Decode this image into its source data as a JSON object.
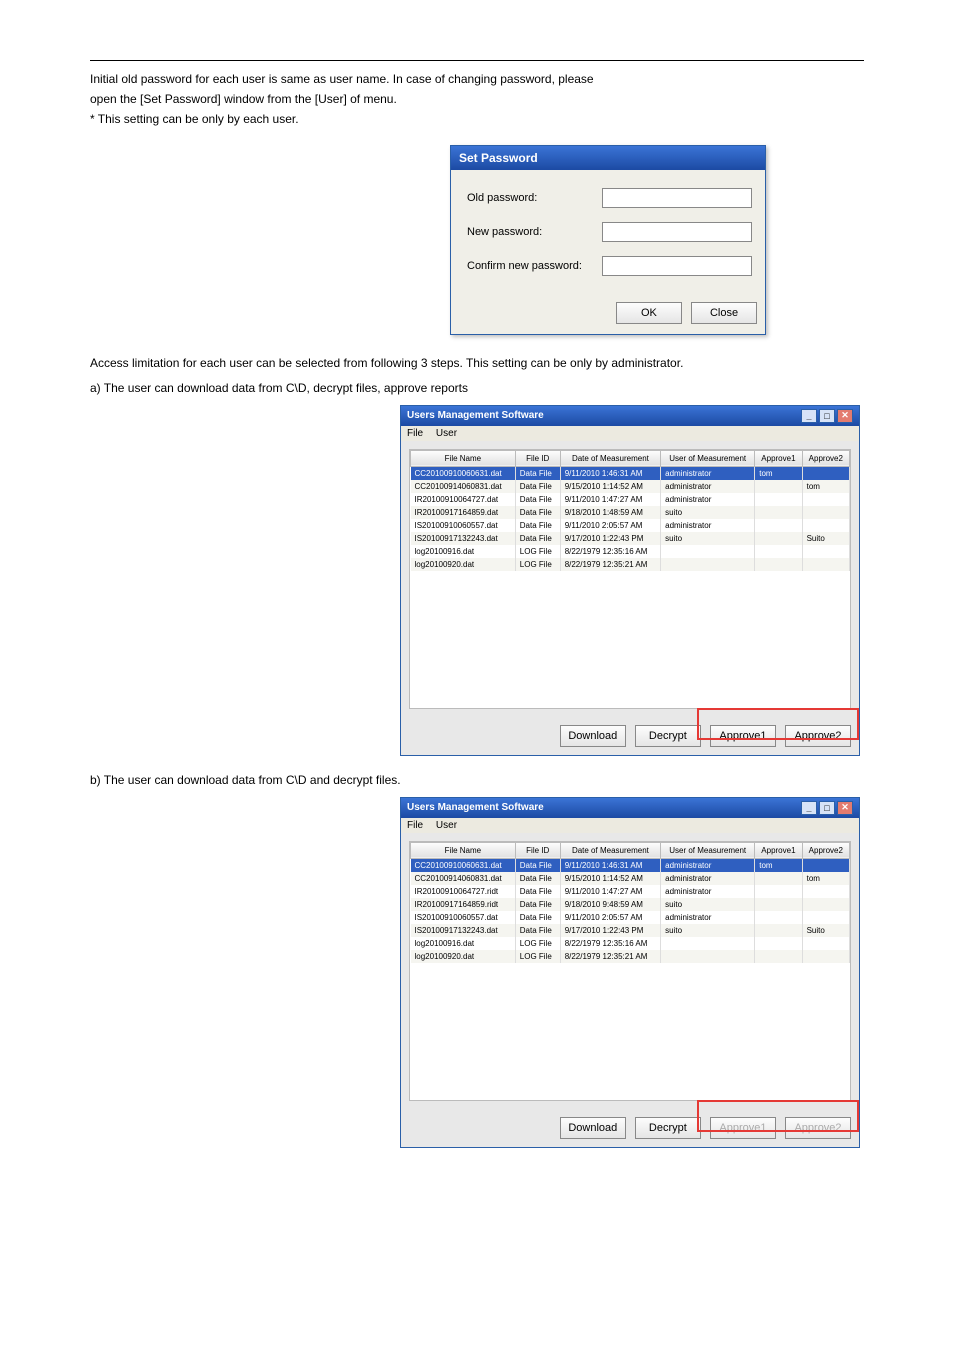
{
  "intro_lines": [
    "Initial old password for each user is same as user name. In case of changing password, please",
    "open the [Set Password] window from the [User] of menu.",
    "* This setting can be only by each user."
  ],
  "set_password_dialog": {
    "title": "Set Password",
    "old_label": "Old password:",
    "new_label": "New password:",
    "confirm_label": "Confirm new password:",
    "ok": "OK",
    "close": "Close"
  },
  "note_text": "Access limitation for each user can be selected from following 3 steps. This setting can be only by administrator.",
  "bullet_a": "a) The user can download data from C\\D, decrypt files, approve reports",
  "app": {
    "title": "Users Management Software",
    "menu_file": "File",
    "menu_user": "User",
    "columns": [
      "File Name",
      "File ID",
      "Date of Measurement",
      "User of Measurement",
      "Approve1",
      "Approve2"
    ],
    "rows": [
      {
        "name": "CC20100910060631.dat",
        "id": "Data File",
        "date": "9/11/2010 1:46:31 AM",
        "user": "administrator",
        "a1": "tom",
        "a2": ""
      },
      {
        "name": "CC20100914060831.dat",
        "id": "Data File",
        "date": "9/15/2010 1:14:52 AM",
        "user": "administrator",
        "a1": "",
        "a2": "tom"
      },
      {
        "name": "IR20100910064727.dat",
        "id": "Data File",
        "date": "9/11/2010 1:47:27 AM",
        "user": "administrator",
        "a1": "",
        "a2": ""
      },
      {
        "name": "IR20100917164859.dat",
        "id": "Data File",
        "date": "9/18/2010 1:48:59 AM",
        "user": "suito",
        "a1": "",
        "a2": ""
      },
      {
        "name": "IS20100910060557.dat",
        "id": "Data File",
        "date": "9/11/2010 2:05:57 AM",
        "user": "administrator",
        "a1": "",
        "a2": ""
      },
      {
        "name": "IS20100917132243.dat",
        "id": "Data File",
        "date": "9/17/2010 1:22:43 PM",
        "user": "suito",
        "a1": "",
        "a2": "Suito"
      },
      {
        "name": "log20100916.dat",
        "id": "LOG File",
        "date": "8/22/1979 12:35:16 AM",
        "user": "",
        "a1": "",
        "a2": ""
      },
      {
        "name": "log20100920.dat",
        "id": "LOG File",
        "date": "8/22/1979 12:35:21 AM",
        "user": "",
        "a1": "",
        "a2": ""
      }
    ],
    "rows2": [
      {
        "name": "CC20100910060631.dat",
        "id": "Data File",
        "date": "9/11/2010 1:46:31 AM",
        "user": "administrator",
        "a1": "tom",
        "a2": ""
      },
      {
        "name": "CC20100914060831.dat",
        "id": "Data File",
        "date": "9/15/2010 1:14:52 AM",
        "user": "administrator",
        "a1": "",
        "a2": "tom"
      },
      {
        "name": "IR20100910064727.ridt",
        "id": "Data File",
        "date": "9/11/2010 1:47:27 AM",
        "user": "administrator",
        "a1": "",
        "a2": ""
      },
      {
        "name": "IR20100917164859.ridt",
        "id": "Data File",
        "date": "9/18/2010 9:48:59 AM",
        "user": "suito",
        "a1": "",
        "a2": ""
      },
      {
        "name": "IS20100910060557.dat",
        "id": "Data File",
        "date": "9/11/2010 2:05:57 AM",
        "user": "administrator",
        "a1": "",
        "a2": ""
      },
      {
        "name": "IS20100917132243.dat",
        "id": "Data File",
        "date": "9/17/2010 1:22:43 PM",
        "user": "suito",
        "a1": "",
        "a2": "Suito"
      },
      {
        "name": "log20100916.dat",
        "id": "LOG File",
        "date": "8/22/1979 12:35:16 AM",
        "user": "",
        "a1": "",
        "a2": ""
      },
      {
        "name": "log20100920.dat",
        "id": "LOG File",
        "date": "8/22/1979 12:35:21 AM",
        "user": "",
        "a1": "",
        "a2": ""
      }
    ],
    "btn_download": "Download",
    "btn_decrypt": "Decrypt",
    "btn_approve1": "Approve1",
    "btn_approve2": "Approve2"
  },
  "bullet_b": "b) The user can download data from C\\D and decrypt files."
}
